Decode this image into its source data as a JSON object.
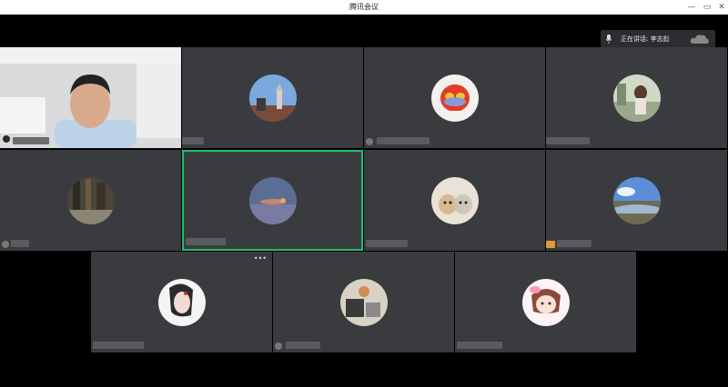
{
  "window": {
    "title": "腾讯会议",
    "controls": {
      "minimize": "—",
      "restore": "▭",
      "close": "✕"
    }
  },
  "speaking_indicator": {
    "text": "正在讲话: 李志彪"
  },
  "participants": [
    {
      "type": "video"
    },
    {
      "type": "avatar",
      "avatar": "building-icon"
    },
    {
      "type": "avatar",
      "avatar": "cartoon-icon"
    },
    {
      "type": "avatar",
      "avatar": "girl-photo-icon"
    },
    {
      "type": "avatar",
      "avatar": "forest-icon"
    },
    {
      "type": "avatar",
      "avatar": "moon-sky-icon",
      "active": true
    },
    {
      "type": "avatar",
      "avatar": "cats-icon"
    },
    {
      "type": "avatar",
      "avatar": "landscape-icon"
    },
    {
      "type": "avatar",
      "avatar": "portrait-sketch-icon"
    },
    {
      "type": "avatar",
      "avatar": "photo-icon"
    },
    {
      "type": "avatar",
      "avatar": "anime-girl-icon"
    }
  ],
  "colors": {
    "background": "#000000",
    "tile": "#3a3b3e",
    "active_border": "#1fbf6f"
  }
}
